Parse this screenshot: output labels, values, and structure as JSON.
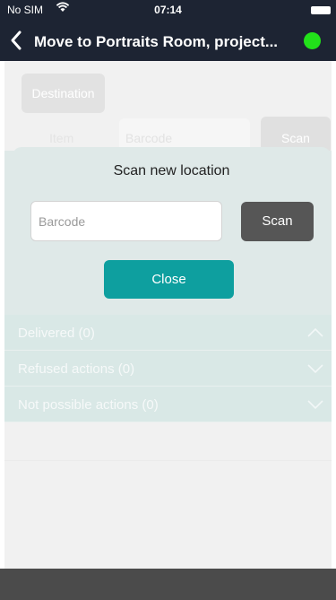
{
  "status_bar": {
    "carrier": "No SIM",
    "time": "07:14"
  },
  "nav": {
    "title": "Move to Portraits Room, project..."
  },
  "page": {
    "destination_label": "Destination",
    "item_label": "Item",
    "barcode_placeholder": "Barcode",
    "scan_label": "Scan",
    "sections": [
      {
        "label": "Delivered (0)",
        "expanded": true
      },
      {
        "label": "Refused actions (0)",
        "expanded": false
      },
      {
        "label": "Not possible actions (0)",
        "expanded": false
      }
    ]
  },
  "modal": {
    "title": "Scan new location",
    "barcode_placeholder": "Barcode",
    "scan_label": "Scan",
    "close_label": "Close"
  },
  "colors": {
    "nav_bg": "#1d2433",
    "online_dot": "#22e11a",
    "accent": "#0e9f9f"
  }
}
